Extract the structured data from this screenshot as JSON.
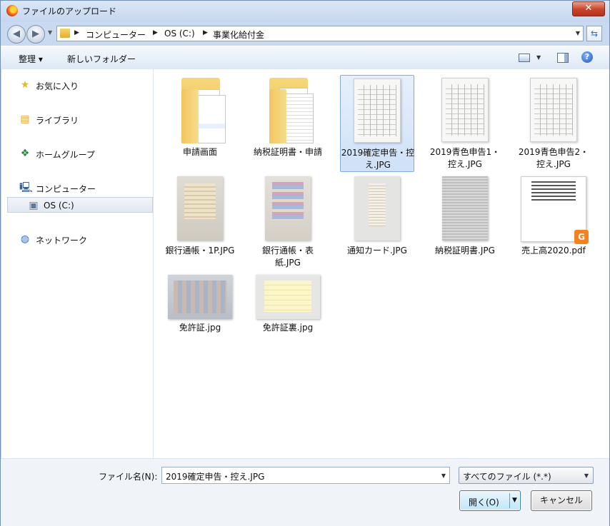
{
  "window": {
    "title": "ファイルのアップロード",
    "close_label": "✕"
  },
  "address": {
    "crumbs": [
      "コンピューター",
      "OS (C:)",
      "事業化給付金"
    ]
  },
  "toolbar": {
    "organize_label": "整理 ▾",
    "new_folder_label": "新しいフォルダー"
  },
  "sidebar": {
    "items": [
      {
        "label": "お気に入り",
        "icon": "star-icon"
      },
      {
        "label": "ライブラリ",
        "icon": "library-icon"
      },
      {
        "label": "ホームグループ",
        "icon": "homegroup-icon"
      },
      {
        "label": "コンピューター",
        "icon": "computer-icon"
      },
      {
        "label": "OS (C:)",
        "icon": "drive-icon"
      },
      {
        "label": "ネットワーク",
        "icon": "network-icon"
      }
    ]
  },
  "files": [
    {
      "name": "申請画面",
      "type": "folder"
    },
    {
      "name": "納税証明書・申請",
      "type": "folder"
    },
    {
      "name": "2019確定申告・控え.JPG",
      "type": "image"
    },
    {
      "name": "2019青色申告1・控え.JPG",
      "type": "image"
    },
    {
      "name": "2019青色申告2・控え.JPG",
      "type": "image"
    },
    {
      "name": "銀行通帳・1P.JPG",
      "type": "image"
    },
    {
      "name": "銀行通帳・表紙.JPG",
      "type": "image"
    },
    {
      "name": "通知カード.JPG",
      "type": "image"
    },
    {
      "name": "納税証明書.JPG",
      "type": "image"
    },
    {
      "name": "売上高2020.pdf",
      "type": "pdf"
    },
    {
      "name": "免許証.jpg",
      "type": "image"
    },
    {
      "name": "免許証裏.jpg",
      "type": "image"
    }
  ],
  "filename": {
    "label": "ファイル名(N):",
    "value": "2019確定申告・控え.JPG"
  },
  "filetype": {
    "value": "すべてのファイル (*.*)"
  },
  "buttons": {
    "open_label": "開く(O)",
    "cancel_label": "キャンセル"
  }
}
